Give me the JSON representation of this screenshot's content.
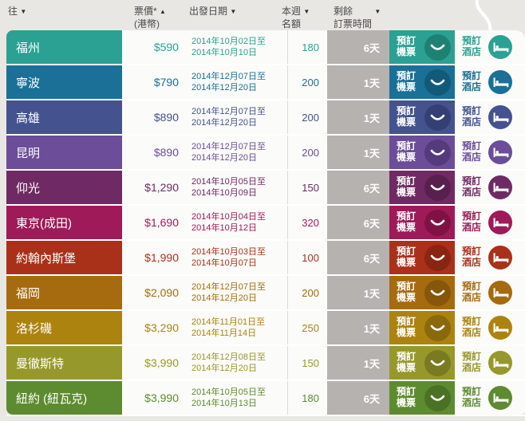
{
  "header": {
    "col_destination": "往",
    "col_price_line1": "票價*",
    "col_price_line2": "(港幣)",
    "col_departure": "出發日期",
    "col_quota_line1": "本週",
    "col_quota_line2": "名額",
    "col_remaining_line1": "剩餘",
    "col_remaining_line2": "訂票時間",
    "sort_asc_icon": "▲",
    "sort_desc_icon": "▼"
  },
  "buttons": {
    "book_flight_line1": "預訂",
    "book_flight_line2": "機票",
    "book_hotel_line1": "預訂",
    "book_hotel_line2": "酒店"
  },
  "colors": {
    "page_background": "#e9e7e3",
    "remaining_cell_gray": "#b5b2af",
    "white_cell": "#fbfbf9"
  },
  "rows": [
    {
      "destination": "福州",
      "price": "$590",
      "date_line1": "2014年10月02日至",
      "date_line2": "2014年10月10日",
      "quota": "180",
      "remaining": "6天",
      "color": "#2aa192",
      "color_dark": "#1e8173"
    },
    {
      "destination": "寧波",
      "price": "$790",
      "date_line1": "2014年12月07日至",
      "date_line2": "2014年12月20日",
      "quota": "200",
      "remaining": "1天",
      "color": "#1a7096",
      "color_dark": "#135978"
    },
    {
      "destination": "高雄",
      "price": "$890",
      "date_line1": "2014年12月07日至",
      "date_line2": "2014年12月20日",
      "quota": "200",
      "remaining": "1天",
      "color": "#44528f",
      "color_dark": "#344073"
    },
    {
      "destination": "昆明",
      "price": "$890",
      "date_line1": "2014年12月07日至",
      "date_line2": "2014年12月20日",
      "quota": "200",
      "remaining": "1天",
      "color": "#6b4d99",
      "color_dark": "#553a7d"
    },
    {
      "destination": "仰光",
      "price": "$1,290",
      "date_line1": "2014年10月05日至",
      "date_line2": "2014年10月09日",
      "quota": "150",
      "remaining": "6天",
      "color": "#6f2a63",
      "color_dark": "#581f4f"
    },
    {
      "destination": "東京(成田)",
      "price": "$1,690",
      "date_line1": "2014年10月04日至",
      "date_line2": "2014年10月12日",
      "quota": "320",
      "remaining": "6天",
      "color": "#9e1a58",
      "color_dark": "#7f1245"
    },
    {
      "destination": "約翰內斯堡",
      "price": "$1,990",
      "date_line1": "2014年10月03日至",
      "date_line2": "2014年10月07日",
      "quota": "100",
      "remaining": "6天",
      "color": "#aa3119",
      "color_dark": "#8a2413"
    },
    {
      "destination": "福岡",
      "price": "$2,090",
      "date_line1": "2014年12月07日至",
      "date_line2": "2014年12月20日",
      "quota": "200",
      "remaining": "1天",
      "color": "#a66b0e",
      "color_dark": "#86560b"
    },
    {
      "destination": "洛杉磯",
      "price": "$3,290",
      "date_line1": "2014年11月01日至",
      "date_line2": "2014年11月14日",
      "quota": "250",
      "remaining": "1天",
      "color": "#ac830f",
      "color_dark": "#8a690c"
    },
    {
      "destination": "曼徹斯特",
      "price": "$3,990",
      "date_line1": "2014年12月08日至",
      "date_line2": "2014年12月20日",
      "quota": "150",
      "remaining": "1天",
      "color": "#97982b",
      "color_dark": "#7a7b21"
    },
    {
      "destination": "紐約 (紐瓦克)",
      "price": "$3,990",
      "date_line1": "2014年10月05日至",
      "date_line2": "2014年10月13日",
      "quota": "180",
      "remaining": "6天",
      "color": "#5d8b2f",
      "color_dark": "#4a7124"
    }
  ]
}
